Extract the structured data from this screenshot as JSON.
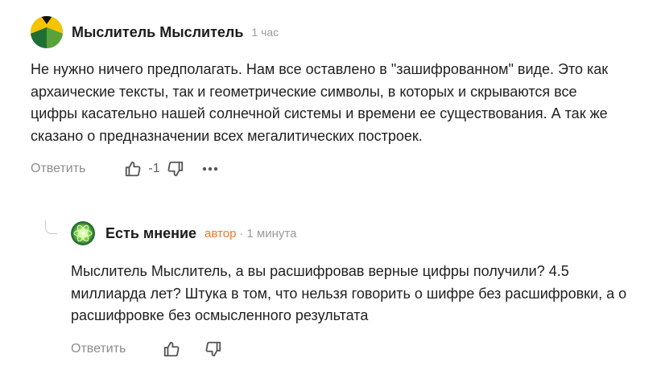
{
  "comments": [
    {
      "author": "Мыслитель Мыслитель",
      "time": "1 час",
      "text": "Не нужно ничего предполагать. Нам все оставлено в \"зашифрованном\" виде. Это как архаические тексты, так и геометрические символы, в которых и скрываются все цифры касательно нашей солнечной системы и времени ее существования. А так же сказано о предназначении всех мегалитических построек.",
      "reply_label": "Ответить",
      "score": "-1",
      "avatar_colors": {
        "top": "#f5c400",
        "bottom": "#3f8f2e",
        "left": "#1f6f35"
      }
    },
    {
      "author": "Есть мнение",
      "badge": "автор",
      "separator": "·",
      "time": "1 минута",
      "text": "Мыслитель Мыслитель, а вы расшифровав верные цифры получили? 4.5 миллиарда лет? Штука в том, что нельзя говорить о шифре без расшифровки, а о расшифровке без осмысленного результата",
      "reply_label": "Ответить",
      "avatar_colors": {
        "background": "#0f5a2a",
        "glow": "#a8ff4a"
      }
    }
  ],
  "colors": {
    "badge": "#f07a23",
    "meta": "#9a9a9a",
    "action": "#8c8c8c"
  }
}
